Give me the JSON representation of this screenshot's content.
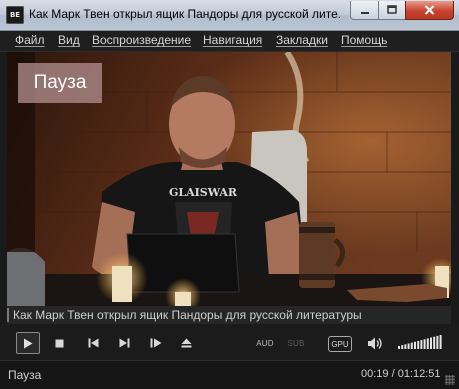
{
  "window": {
    "title": "Как Марк Твен открыл ящик Пандоры для русской лите...",
    "app_icon_label": "BE",
    "buttons": {
      "minimize_icon": "minimize-icon",
      "maximize_icon": "maximize-icon",
      "close_icon": "close-icon"
    }
  },
  "menu": {
    "items": [
      {
        "label": "Файл"
      },
      {
        "label": "Вид"
      },
      {
        "label": "Воспроизведение"
      },
      {
        "label": "Навигация"
      },
      {
        "label": "Закладки"
      },
      {
        "label": "Помощь"
      }
    ]
  },
  "video": {
    "osd_text": "Пауза",
    "shirt_text": "GLAISWAR"
  },
  "caption": "Как Марк Твен открыл ящик Пандоры для русской литературы",
  "controls": {
    "play_icon": "play-icon",
    "stop_icon": "stop-icon",
    "prev_icon": "skip-back-icon",
    "next_icon": "skip-forward-icon",
    "frame_step_icon": "frame-step-icon",
    "eject_icon": "eject-icon",
    "audio_label": "AUD",
    "subtitle_label": "SUB",
    "gpu_label": "GPU",
    "volume_icon": "speaker-icon",
    "volume_level": 1.0
  },
  "status": {
    "state": "Пауза",
    "time": "00:19 / 01:12:51"
  },
  "colors": {
    "menu_bg": "#1f1f1f",
    "control_bg": "#1b1b1b",
    "close_red": "#c7432f",
    "text_light": "#d6d6d6"
  }
}
